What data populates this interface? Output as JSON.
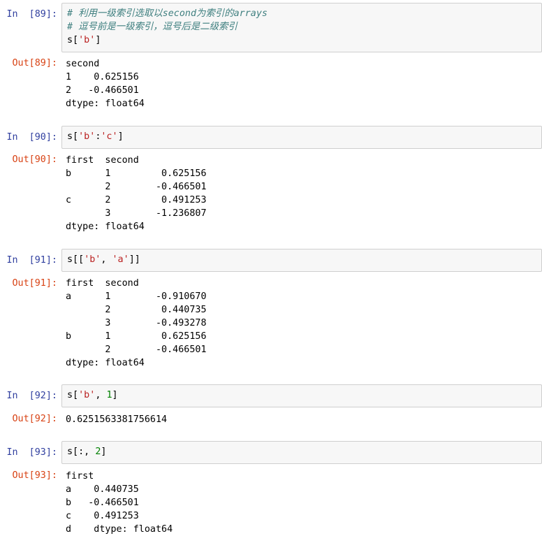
{
  "cells": [
    {
      "in_prompt": "In  [89]:",
      "out_prompt": "Out[89]:",
      "code": [
        [
          {
            "t": "comment",
            "v": "# 利用一级索引选取以second为索引的arrays"
          }
        ],
        [
          {
            "t": "comment",
            "v": "# 逗号前是一级索引，逗号后是二级索引"
          }
        ],
        [
          {
            "t": "op",
            "v": "s["
          },
          {
            "t": "str",
            "v": "'b'"
          },
          {
            "t": "op",
            "v": "]"
          }
        ]
      ],
      "output": [
        "second",
        "1    0.625156",
        "2   -0.466501",
        "dtype: float64"
      ]
    },
    {
      "in_prompt": "In  [90]:",
      "out_prompt": "Out[90]:",
      "code": [
        [
          {
            "t": "op",
            "v": "s["
          },
          {
            "t": "str",
            "v": "'b'"
          },
          {
            "t": "op",
            "v": ":"
          },
          {
            "t": "str",
            "v": "'c'"
          },
          {
            "t": "op",
            "v": "]"
          }
        ]
      ],
      "output": [
        "first  second",
        "b      1         0.625156",
        "       2        -0.466501",
        "c      2         0.491253",
        "       3        -1.236807",
        "dtype: float64"
      ]
    },
    {
      "in_prompt": "In  [91]:",
      "out_prompt": "Out[91]:",
      "code": [
        [
          {
            "t": "op",
            "v": "s[["
          },
          {
            "t": "str",
            "v": "'b'"
          },
          {
            "t": "op",
            "v": ", "
          },
          {
            "t": "str",
            "v": "'a'"
          },
          {
            "t": "op",
            "v": "]]"
          }
        ]
      ],
      "output": [
        "first  second",
        "a      1        -0.910670",
        "       2         0.440735",
        "       3        -0.493278",
        "b      1         0.625156",
        "       2        -0.466501",
        "dtype: float64"
      ]
    },
    {
      "in_prompt": "In  [92]:",
      "out_prompt": "Out[92]:",
      "code": [
        [
          {
            "t": "op",
            "v": "s["
          },
          {
            "t": "str",
            "v": "'b'"
          },
          {
            "t": "op",
            "v": ", "
          },
          {
            "t": "num",
            "v": "1"
          },
          {
            "t": "op",
            "v": "]"
          }
        ]
      ],
      "output": [
        "0.6251563381756614"
      ]
    },
    {
      "in_prompt": "In  [93]:",
      "out_prompt": "Out[93]:",
      "code": [
        [
          {
            "t": "op",
            "v": "s[:, "
          },
          {
            "t": "num",
            "v": "2"
          },
          {
            "t": "op",
            "v": "]"
          }
        ]
      ],
      "output": [
        "first",
        "a    0.440735",
        "b   -0.466501",
        "c    0.491253",
        "d    dtype: float64"
      ]
    }
  ],
  "colors": {
    "in_prompt": "#303f9f",
    "out_prompt": "#d84315",
    "comment": "#408080",
    "string": "#ba2121",
    "number": "#008000",
    "input_bg": "#f7f7f7",
    "input_border": "#cfcfcf"
  }
}
